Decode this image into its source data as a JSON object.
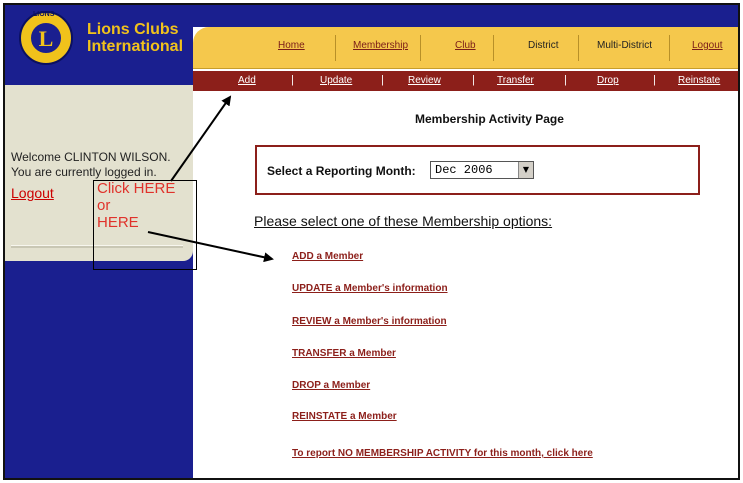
{
  "brand": {
    "name_line1": "Lions Clubs",
    "name_line2": "International",
    "logo_text": "LIONS",
    "logo_letter": "L"
  },
  "sidebar": {
    "welcome_line1": "Welcome CLINTON WILSON.",
    "welcome_line2": "You are currently logged in.",
    "logout_label": "Logout"
  },
  "callout": {
    "line1": "Click HERE",
    "line2": "or",
    "line3": "HERE"
  },
  "main_nav": {
    "home": "Home",
    "membership": "Membership",
    "club": "Club",
    "district": "District",
    "multi_district": "Multi-District",
    "logout": "Logout"
  },
  "sub_nav": {
    "add": "Add",
    "update": "Update",
    "review": "Review",
    "transfer": "Transfer",
    "drop": "Drop",
    "reinstate": "Reinstate"
  },
  "page": {
    "title": "Membership Activity Page",
    "month_label": "Select a Reporting Month:",
    "month_value": "Dec 2006",
    "options_heading": "Please select one of these Membership options:"
  },
  "options": {
    "add": "ADD a Member",
    "update": "UPDATE a Member's information",
    "review": "REVIEW a Member's information",
    "transfer": "TRANSFER a Member",
    "drop": "DROP a Member",
    "reinstate": "REINSTATE a Member",
    "no_activity": "To report NO MEMBERSHIP ACTIVITY for this month, click here"
  },
  "colors": {
    "navy": "#1a1f8f",
    "gold": "#f5c84c",
    "maroon": "#8c1f1a",
    "callout_red": "#e0322b"
  }
}
